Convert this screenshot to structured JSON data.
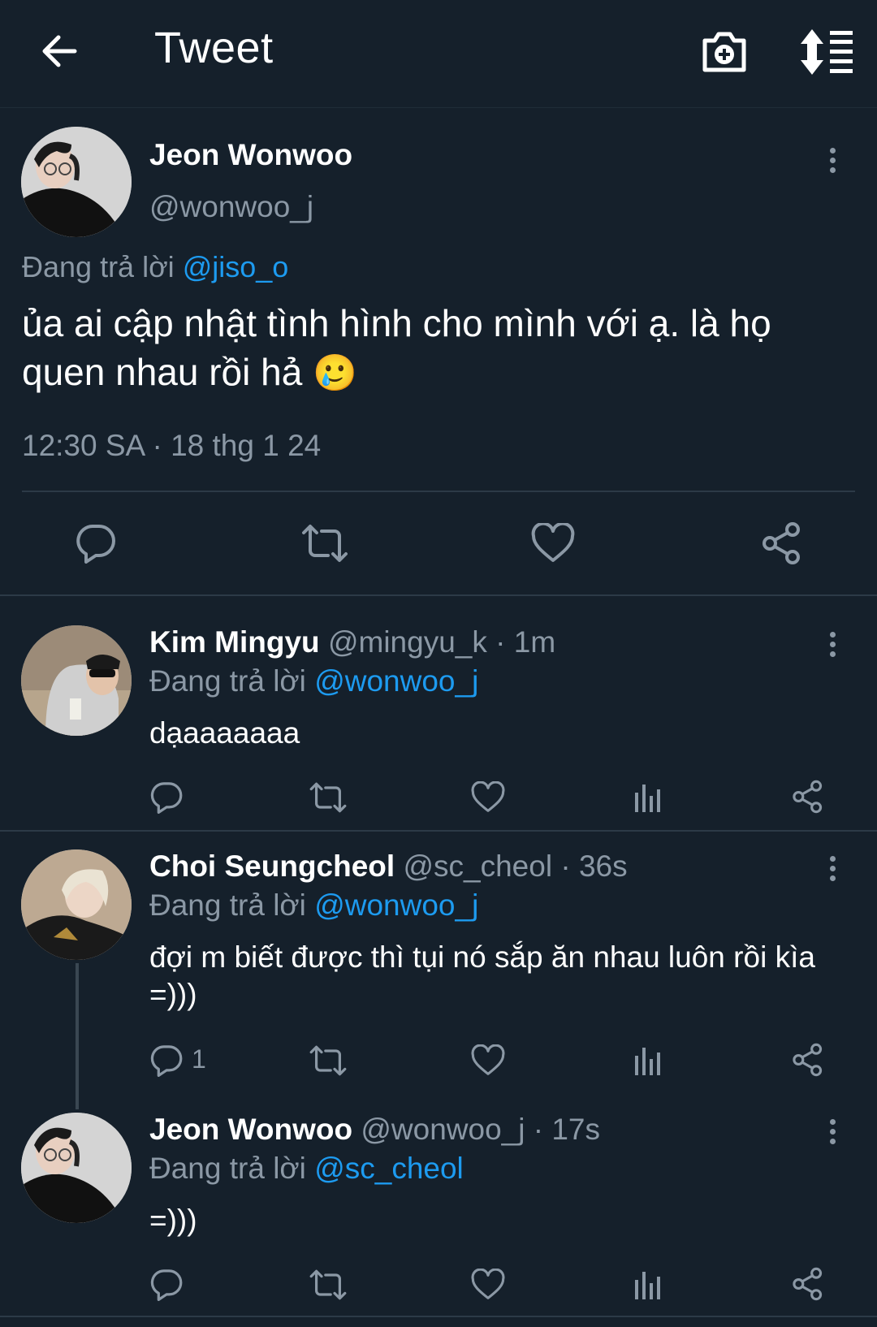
{
  "header": {
    "title": "Tweet",
    "back_icon": "arrow-left-icon",
    "camera_icon": "camera-plus-icon",
    "sort_icon": "sort-icon"
  },
  "main_tweet": {
    "name": "Jeon Wonwoo",
    "handle": "@wonwoo_j",
    "replying_prefix": "Đang trả lời",
    "replying_to": "@jiso_o",
    "text_line1": "ủa ai cập nhật tình hình cho mình với ạ. là họ",
    "text_line2": "quen nhau rồi hả",
    "emoji": "🥲",
    "timestamp": "12:30 SA · 18 thg 1 24"
  },
  "replies": [
    {
      "name": "Kim Mingyu",
      "handle": "@mingyu_k",
      "time": "· 1m",
      "replying_prefix": "Đang trả lời",
      "replying_to": "@wonwoo_j",
      "text": "dạaaaaaaa",
      "reply_count": ""
    },
    {
      "name": "Choi Seungcheol",
      "handle": "@sc_cheol",
      "time": "· 36s",
      "replying_prefix": "Đang trả lời",
      "replying_to": "@wonwoo_j",
      "text": "đợi m biết được thì tụi nó sắp ăn nhau luôn rồi kìa =)))",
      "reply_count": "1"
    },
    {
      "name": "Jeon Wonwoo",
      "handle": "@wonwoo_j",
      "time": "· 17s",
      "replying_prefix": "Đang trả lời",
      "replying_to": "@sc_cheol",
      "text": "=)))",
      "reply_count": ""
    }
  ],
  "colors": {
    "background": "#15202b",
    "link": "#1d9bf0",
    "muted": "#8b98a5",
    "divider": "#2c3a47"
  }
}
